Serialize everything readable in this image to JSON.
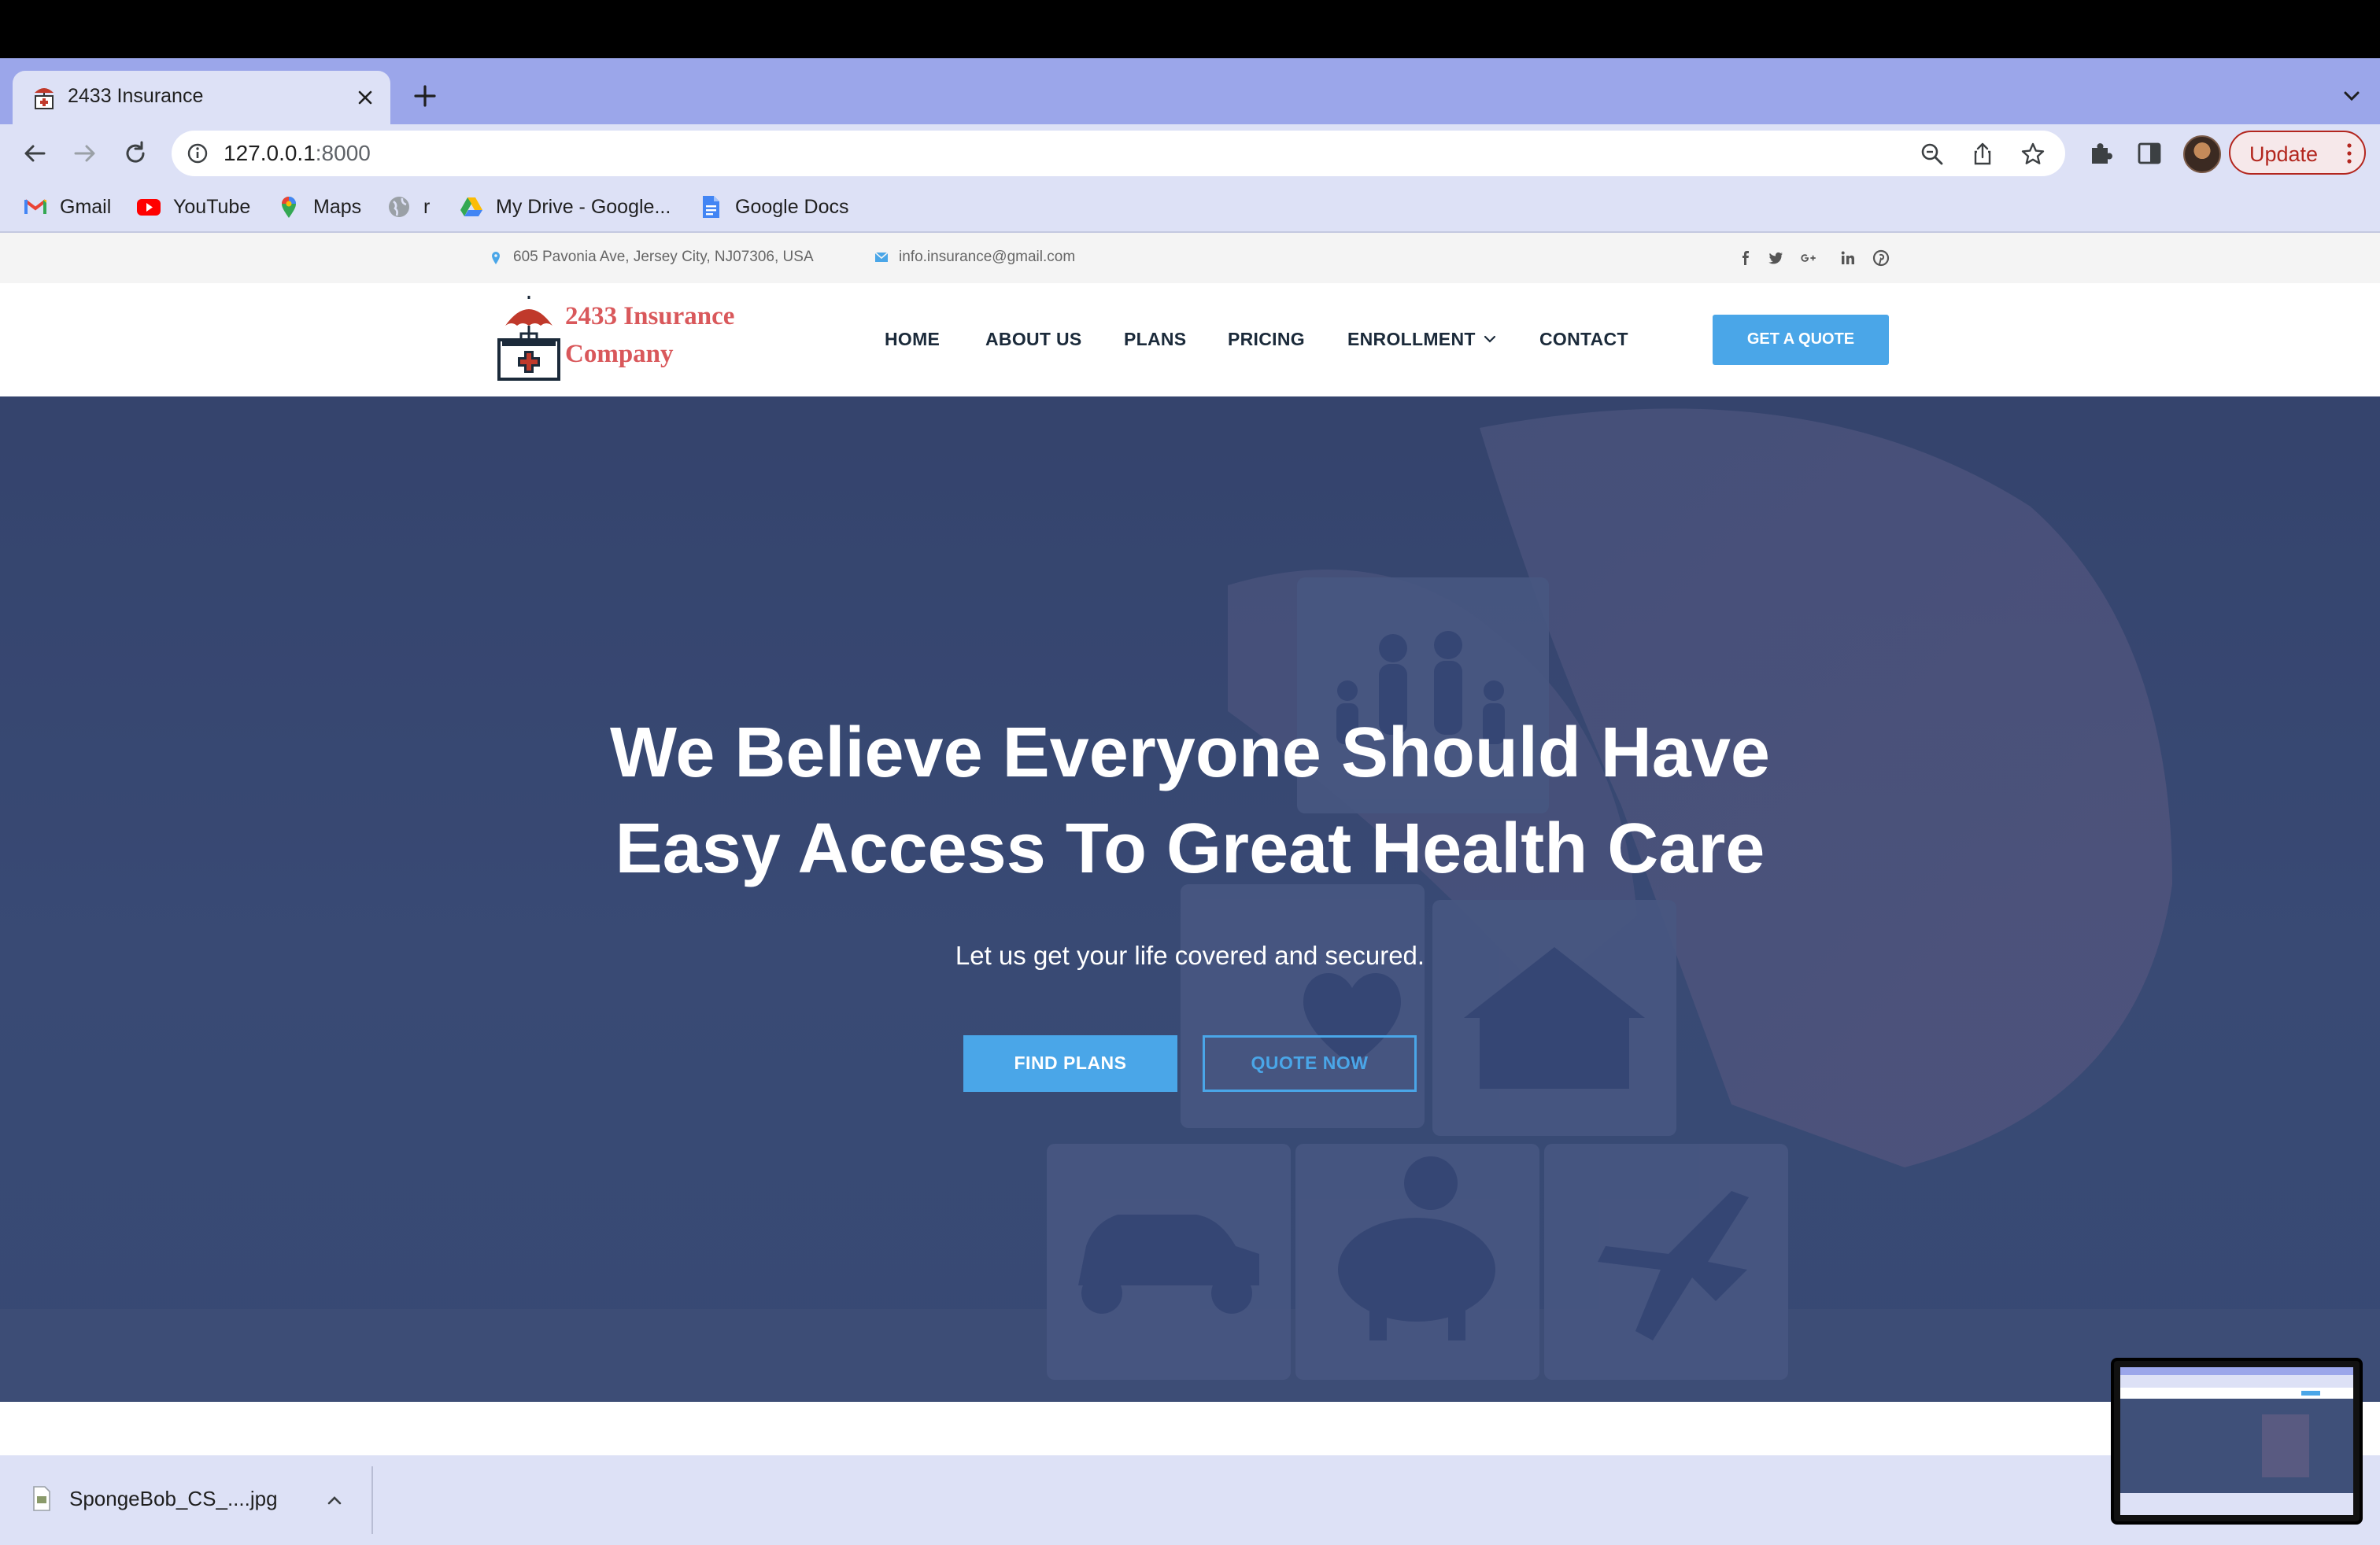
{
  "browser": {
    "tab_title": "2433 Insurance",
    "url_host": "127.0.0.1",
    "url_port": ":8000",
    "update_label": "Update"
  },
  "bookmarks": [
    {
      "label": "Gmail",
      "icon": "gmail-icon"
    },
    {
      "label": "YouTube",
      "icon": "youtube-icon"
    },
    {
      "label": "Maps",
      "icon": "maps-icon"
    },
    {
      "label": "r",
      "icon": "globe-icon"
    },
    {
      "label": "My Drive - Google...",
      "icon": "drive-icon"
    },
    {
      "label": "Google Docs",
      "icon": "docs-icon"
    }
  ],
  "site": {
    "address": "605 Pavonia Ave, Jersey City, NJ07306, USA",
    "email": "info.insurance@gmail.com",
    "social": [
      "facebook-icon",
      "twitter-icon",
      "google-plus-icon",
      "linkedin-icon",
      "pinterest-icon"
    ],
    "logo_line1": "2433 Insurance",
    "logo_line2": "Company",
    "menu": [
      "HOME",
      "ABOUT US",
      "PLANS",
      "PRICING",
      "ENROLLMENT",
      "CONTACT"
    ],
    "cta": "GET A QUOTE",
    "accent_color": "#4aa6e8",
    "logo_color": "#d9585b"
  },
  "hero": {
    "headline_line1": "We Believe Everyone Should Have",
    "headline_line2": "Easy Access To Great Health Care",
    "subtitle": "Let us get your life covered and secured.",
    "primary_button": "FIND PLANS",
    "secondary_button": "QUOTE NOW"
  },
  "downloads": {
    "file_name": "SpongeBob_CS_....jpg"
  }
}
